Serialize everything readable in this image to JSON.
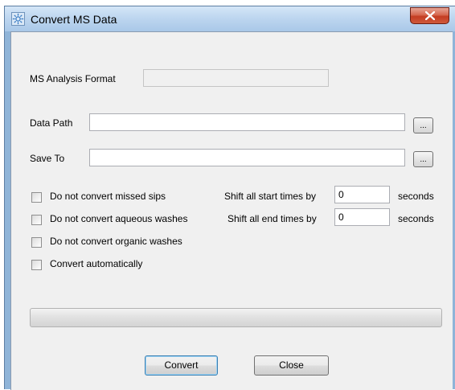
{
  "window": {
    "title": "Convert MS Data",
    "app_icon": "gear-sun-icon",
    "close_icon": "close-x-icon"
  },
  "form": {
    "ms_format_label": "MS Analysis Format",
    "ms_format_value": "",
    "data_path_label": "Data Path",
    "data_path_value": "",
    "data_path_browse": "...",
    "save_to_label": "Save To",
    "save_to_value": "",
    "save_to_browse": "..."
  },
  "options": {
    "checkboxes": [
      {
        "label": "Do not convert missed sips",
        "checked": false
      },
      {
        "label": "Do not convert aqueous washes",
        "checked": false
      },
      {
        "label": "Do not convert organic washes",
        "checked": false
      },
      {
        "label": "Convert automatically",
        "checked": false
      }
    ],
    "shift_start_label": "Shift all start times by",
    "shift_start_value": "0",
    "shift_start_unit": "seconds",
    "shift_end_label": "Shift all end times by",
    "shift_end_value": "0",
    "shift_end_unit": "seconds"
  },
  "progress": {
    "value": 0
  },
  "buttons": {
    "convert": "Convert",
    "close": "Close"
  },
  "colors": {
    "titlebar": "#bcd5ef",
    "close_button": "#c43c22",
    "client_bg": "#f0f0f0"
  }
}
